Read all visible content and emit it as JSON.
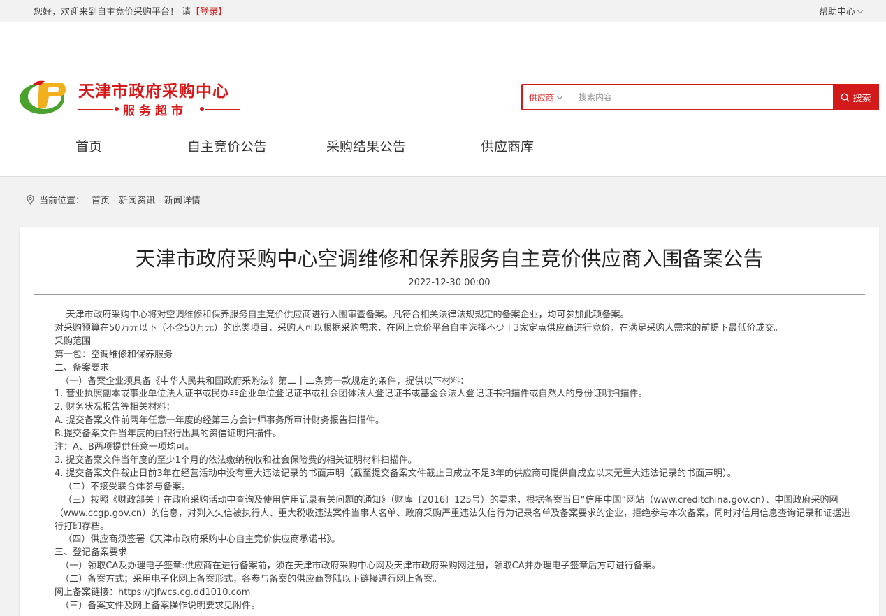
{
  "topbar": {
    "welcome": "您好，欢迎来到自主竞价采购平台！ 请",
    "login": "【登录】",
    "help": "帮助中心"
  },
  "logo": {
    "title": "天津市政府采购中心",
    "subtitle": "服务超市"
  },
  "search": {
    "category": "供应商",
    "placeholder": "搜索内容",
    "button": "搜索"
  },
  "nav": [
    "首页",
    "自主竞价公告",
    "采购结果公告",
    "供应商库"
  ],
  "breadcrumb": {
    "label": "当前位置：",
    "path": "首页 - 新闻资讯 - 新闻详情"
  },
  "article": {
    "title": "天津市政府采购中心空调维修和保养服务自主竞价供应商入围备案公告",
    "date": "2022-12-30 00:00",
    "paragraphs": [
      "    天津市政府采购中心将对空调维修和保养服务自主竞价供应商进行入围审查备案。凡符合相关法律法规规定的备案企业，均可参加此项备案。",
      "对采购预算在50万元以下（不含50万元）的此类项目，采购人可以根据采购需求，在网上竞价平台自主选择不少于3家定点供应商进行竞价，在满足采购人需求的前提下最低价成交。",
      "采购范围",
      "第一包：空调维修和保养服务",
      "二、备案要求",
      "  （一）备案企业须具备《中华人民共和国政府采购法》第二十二条第一款规定的条件，提供以下材料：",
      "1. 营业执照副本或事业单位法人证书或民办非企业单位登记证书或社会团体法人登记证书或基金会法人登记证书扫描件或自然人的身份证明扫描件。",
      "2. 财务状况报告等相关材料：",
      "A. 提交备案文件前两年任意一年度的经第三方会计师事务所审计财务报告扫描件。",
      "B.提交备案文件当年度的由银行出具的资信证明扫描件。",
      "注：A、B两项提供任意一项均可。",
      "3. 提交备案文件当年度的至少1个月的依法缴纳税收和社会保险费的相关证明材料扫描件。",
      "4. 提交备案文件截止日前3年在经营活动中没有重大违法记录的书面声明（截至提交备案文件截止日成立不足3年的供应商可提供自成立以来无重大违法记录的书面声明）。",
      "   （二）不接受联合体参与备案。",
      "   （三）按照《财政部关于在政府采购活动中查询及使用信用记录有关问题的通知》（财库〔2016〕125号）的要求，根据备案当日“信用中国”网站（www.creditchina.gov.cn）、中国政府采购网（www.ccgp.gov.cn）的信息，对列入失信被执行人、重大税收违法案件当事人名单、政府采购严重违法失信行为记录名单及备案要求的企业，拒绝参与本次备案，同时对信用信息查询记录和证据进行打印存档。",
      "   （四）供应商须签署《天津市政府采购中心自主竞价供应商承诺书》。",
      "三、登记备案要求",
      "  （一）领取CA及办理电子签章:供应商在进行备案前，须在天津市政府采购中心网及天津市政府采购网注册，领取CA并办理电子签章后方可进行备案。",
      "  （二）备案方式；采用电子化网上备案形式，各参与备案的供应商登陆以下链接进行网上备案。",
      "网上备案链接：https://tjfwcs.cg.dd1010.com",
      "  （三）备案文件及网上备案操作说明要求见附件。"
    ]
  }
}
